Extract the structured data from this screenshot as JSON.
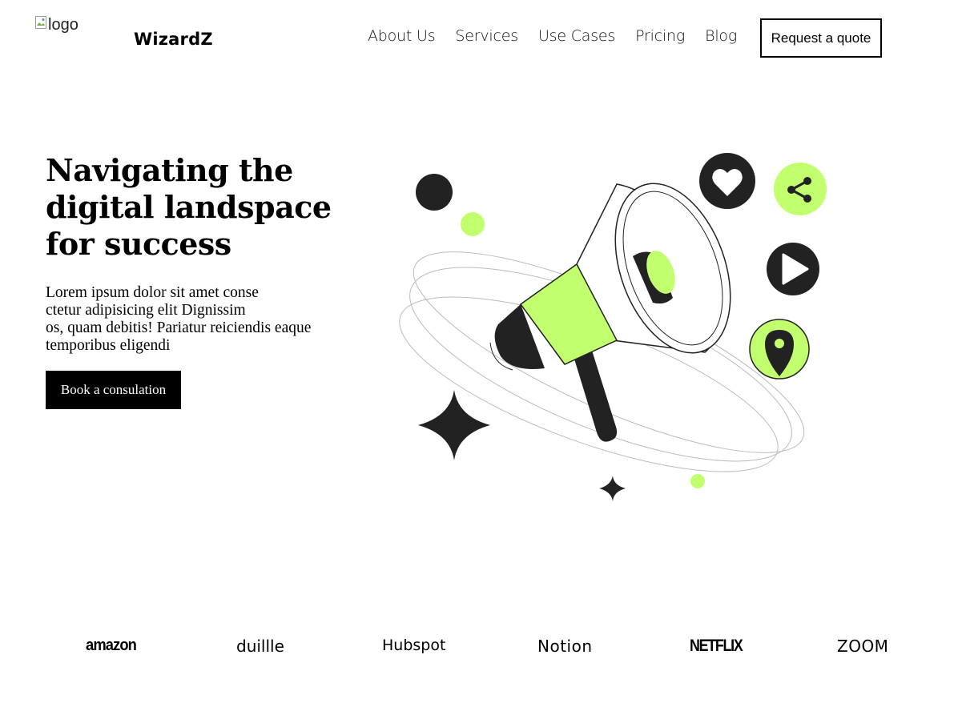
{
  "header": {
    "logo_alt": "logo",
    "brand": "WizardZ",
    "nav": [
      "About Us",
      "Services",
      "Use Cases",
      "Pricing",
      "Blog"
    ],
    "quote_button": "Request a quote"
  },
  "hero": {
    "title": "Navigating the digital landspace for success",
    "text": "Lorem ipsum dolor sit amet conse\nctetur adipisicing elit Dignissim\nos, quam debitis! Pariatur reiciendis eaque\ntemporibus eligendi",
    "cta": "Book a consulation"
  },
  "colors": {
    "accent": "#c2ff6e",
    "dark": "#222222",
    "button_bg": "#000000"
  },
  "illustration": {
    "icons": [
      "megaphone-icon",
      "heart-icon",
      "share-icon",
      "play-icon",
      "location-pin-icon",
      "sparkle-icon"
    ]
  },
  "brands": [
    "amazon",
    "duillle",
    "Hubspot",
    "Notion",
    "NETFLIX",
    "ZOOM"
  ]
}
